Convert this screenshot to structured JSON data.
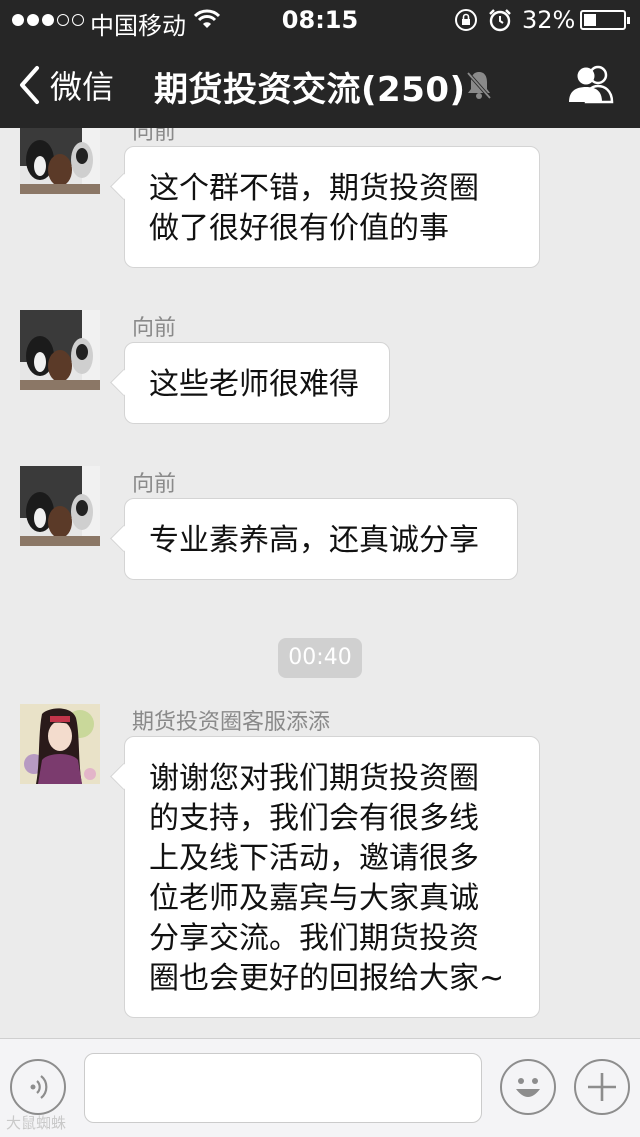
{
  "status_bar": {
    "carrier": "中国移动",
    "time": "08:15",
    "battery_percent": "32%",
    "battery_level": 0.32,
    "signal_bars_filled": 3,
    "signal_bars_total": 5,
    "icons": [
      "wifi-icon",
      "rotation-lock-icon",
      "alarm-icon",
      "battery-icon"
    ]
  },
  "navbar": {
    "back_label": "微信",
    "title": "期货投资交流(250)",
    "icons": [
      "back-chevron-icon",
      "mute-icon",
      "group-members-icon"
    ]
  },
  "messages": [
    {
      "sender": "向前",
      "lines": [
        "这个群不错，期货投资圈",
        "做了很好很有价值的事"
      ],
      "avatar": "dogs-avatar"
    },
    {
      "sender": "向前",
      "lines": [
        "这些老师很难得"
      ],
      "avatar": "dogs-avatar"
    },
    {
      "sender": "向前",
      "lines": [
        "专业素养高，还真诚分享"
      ],
      "avatar": "dogs-avatar"
    },
    {
      "timestamp": "00:40"
    },
    {
      "sender": "期货投资圈客服添添",
      "lines": [
        "谢谢您对我们期货投资圈",
        "的支持，我们会有很多线",
        "上及线下活动，邀请很多",
        "位老师及嘉宾与大家真诚",
        "分享交流。我们期货投资",
        "圈也会更好的回报给大家~"
      ],
      "avatar": "anime-girl-avatar"
    }
  ],
  "input_bar": {
    "icons": [
      "voice-icon",
      "emoji-icon",
      "plus-icon"
    ]
  },
  "watermark": "大鼠蜘蛛",
  "colors": {
    "header_bg": "#262626",
    "chat_bg": "#ebebeb",
    "bubble_bg": "#ffffff",
    "sender_text": "#8a8a8a"
  }
}
